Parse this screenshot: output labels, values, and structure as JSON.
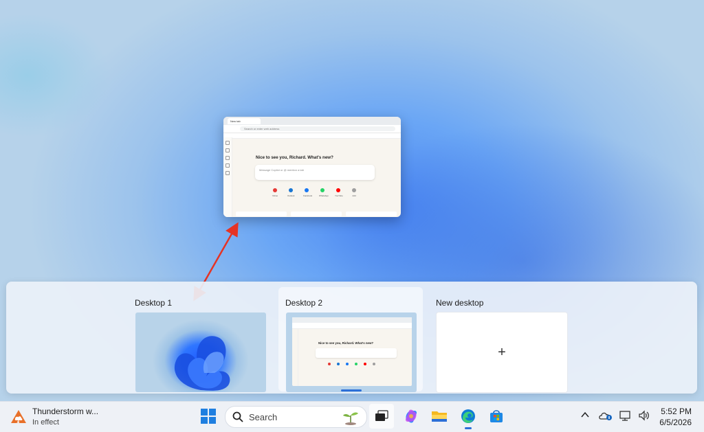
{
  "preview_window": {
    "tab_title": "New tab",
    "address_placeholder": "Search or enter web address",
    "greeting": "Nice to see you, Richard. What's new?",
    "copilot_placeholder": "Message Copilot or @ mention a tab",
    "quick_links": [
      {
        "label": "Yahoo",
        "color": "#e53935"
      },
      {
        "label": "Outlook",
        "color": "#1976d2"
      },
      {
        "label": "Facebook",
        "color": "#1877f2"
      },
      {
        "label": "WhatsApp",
        "color": "#25d366"
      },
      {
        "label": "YouTube",
        "color": "#ff0000"
      },
      {
        "label": "Add",
        "color": "#9e9e9e"
      }
    ]
  },
  "task_view": {
    "desktops": [
      {
        "label": "Desktop 1",
        "active": false
      },
      {
        "label": "Desktop 2",
        "active": true
      },
      {
        "label": "New desktop"
      }
    ],
    "new_desktop_symbol": "+",
    "mini_greeting": "Nice to see you, Richard. What's new?"
  },
  "taskbar": {
    "weather_title": "Thunderstorm w...",
    "weather_subtitle": "In effect",
    "search_label": "Search",
    "apps": [
      "start-icon",
      "task-view-icon",
      "copilot-icon",
      "file-explorer-icon",
      "edge-icon",
      "store-icon"
    ],
    "clock_time": "5:52 PM",
    "clock_date": "6/5/2026"
  },
  "colors": {
    "accent": "#2c6fd8",
    "arrow": "#e53324"
  }
}
